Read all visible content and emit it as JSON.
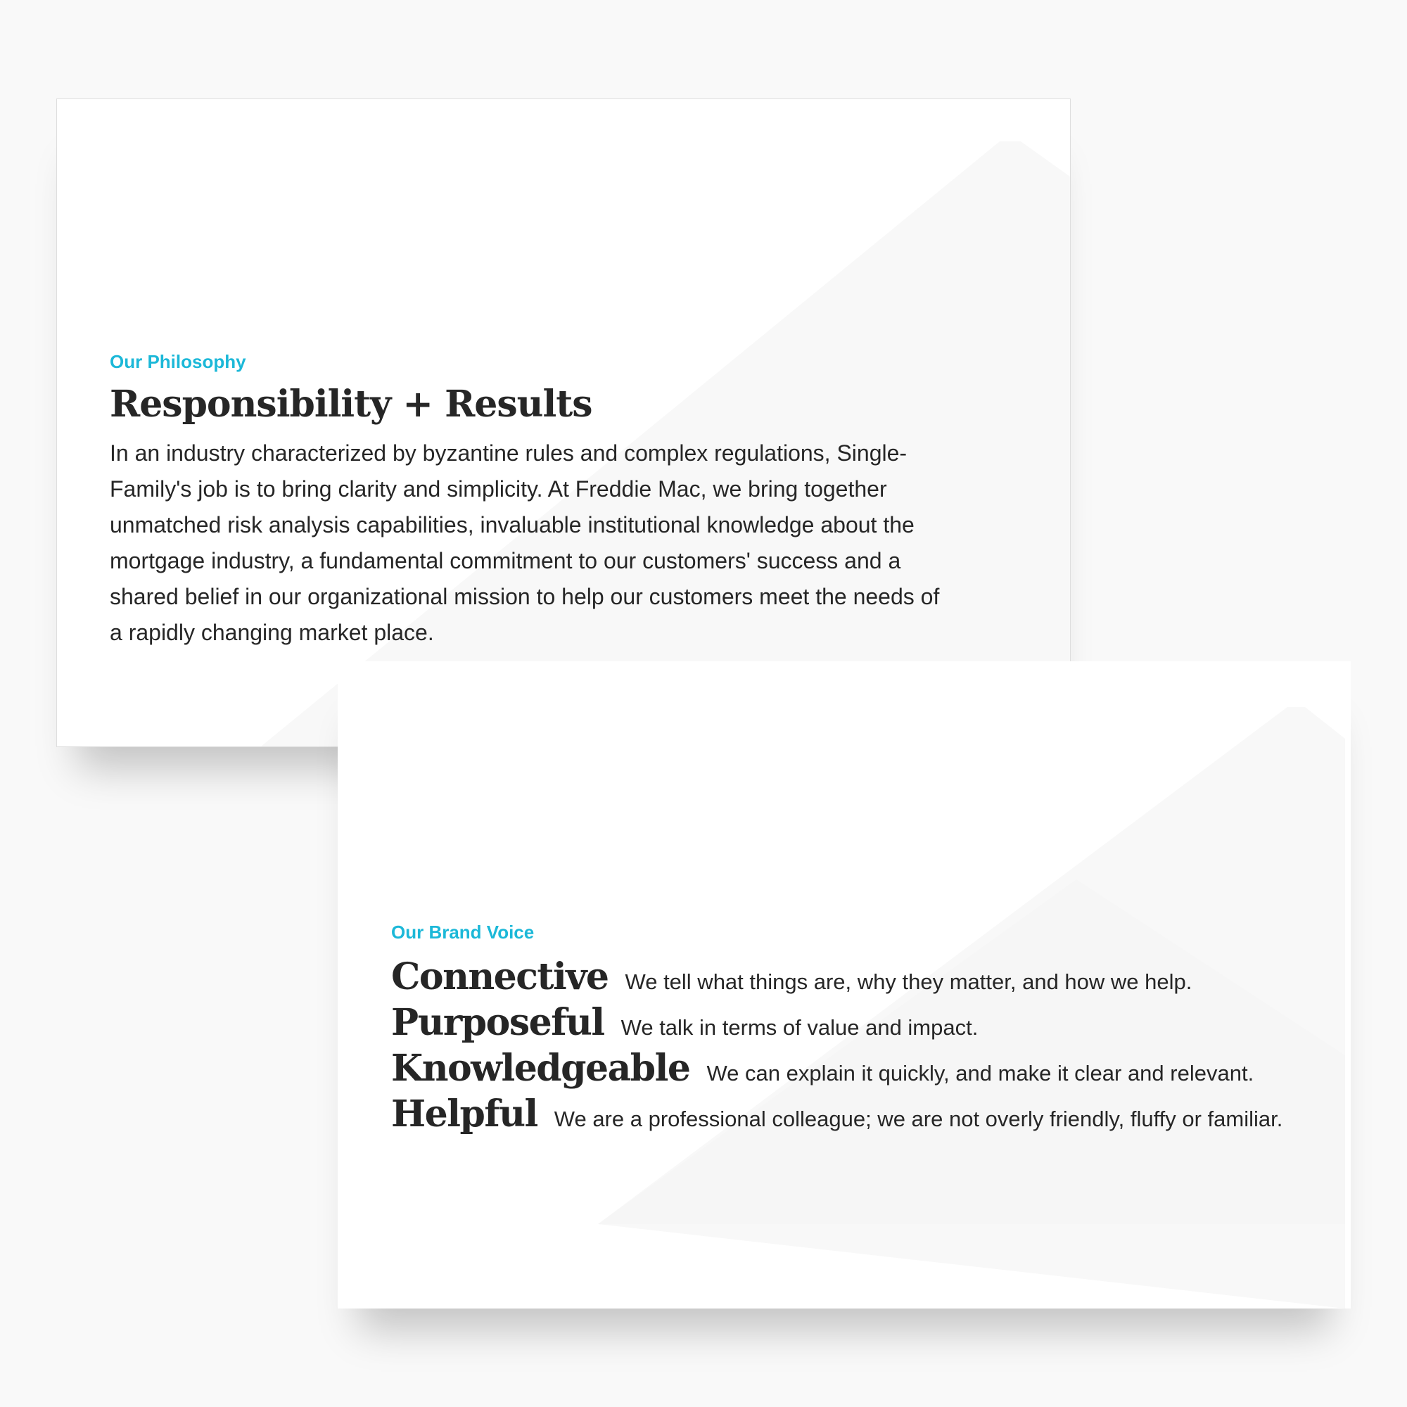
{
  "philosophy": {
    "eyebrow": "Our Philosophy",
    "headline": "Responsibility + Results",
    "body": "In an industry characterized by byzantine rules and complex regulations, Single-Family's job is to bring clarity and simplicity. At Freddie Mac, we bring together unmatched risk analysis capabilities, invaluable institutional knowledge about the mortgage industry, a fundamental commitment to our customers' success and a shared belief in our organizational mission to help our customers meet the needs of a rapidly changing market place."
  },
  "brand_voice": {
    "eyebrow": "Our Brand Voice",
    "items": [
      {
        "term": "Connective",
        "description": "We tell what things are, why they matter, and how we help."
      },
      {
        "term": "Purposeful",
        "description": "We talk in terms of value and impact."
      },
      {
        "term": "Knowledgeable",
        "description": "We can explain it quickly, and make it clear and relevant."
      },
      {
        "term": "Helpful",
        "description": "We are a professional colleague; we are not overly friendly, fluffy or familiar."
      }
    ]
  },
  "colors": {
    "accent": "#1cb8d8",
    "text": "#262626",
    "page_background": "#f9f9f9",
    "slide_background": "#ffffff",
    "watermark": "#f8f8f8"
  }
}
